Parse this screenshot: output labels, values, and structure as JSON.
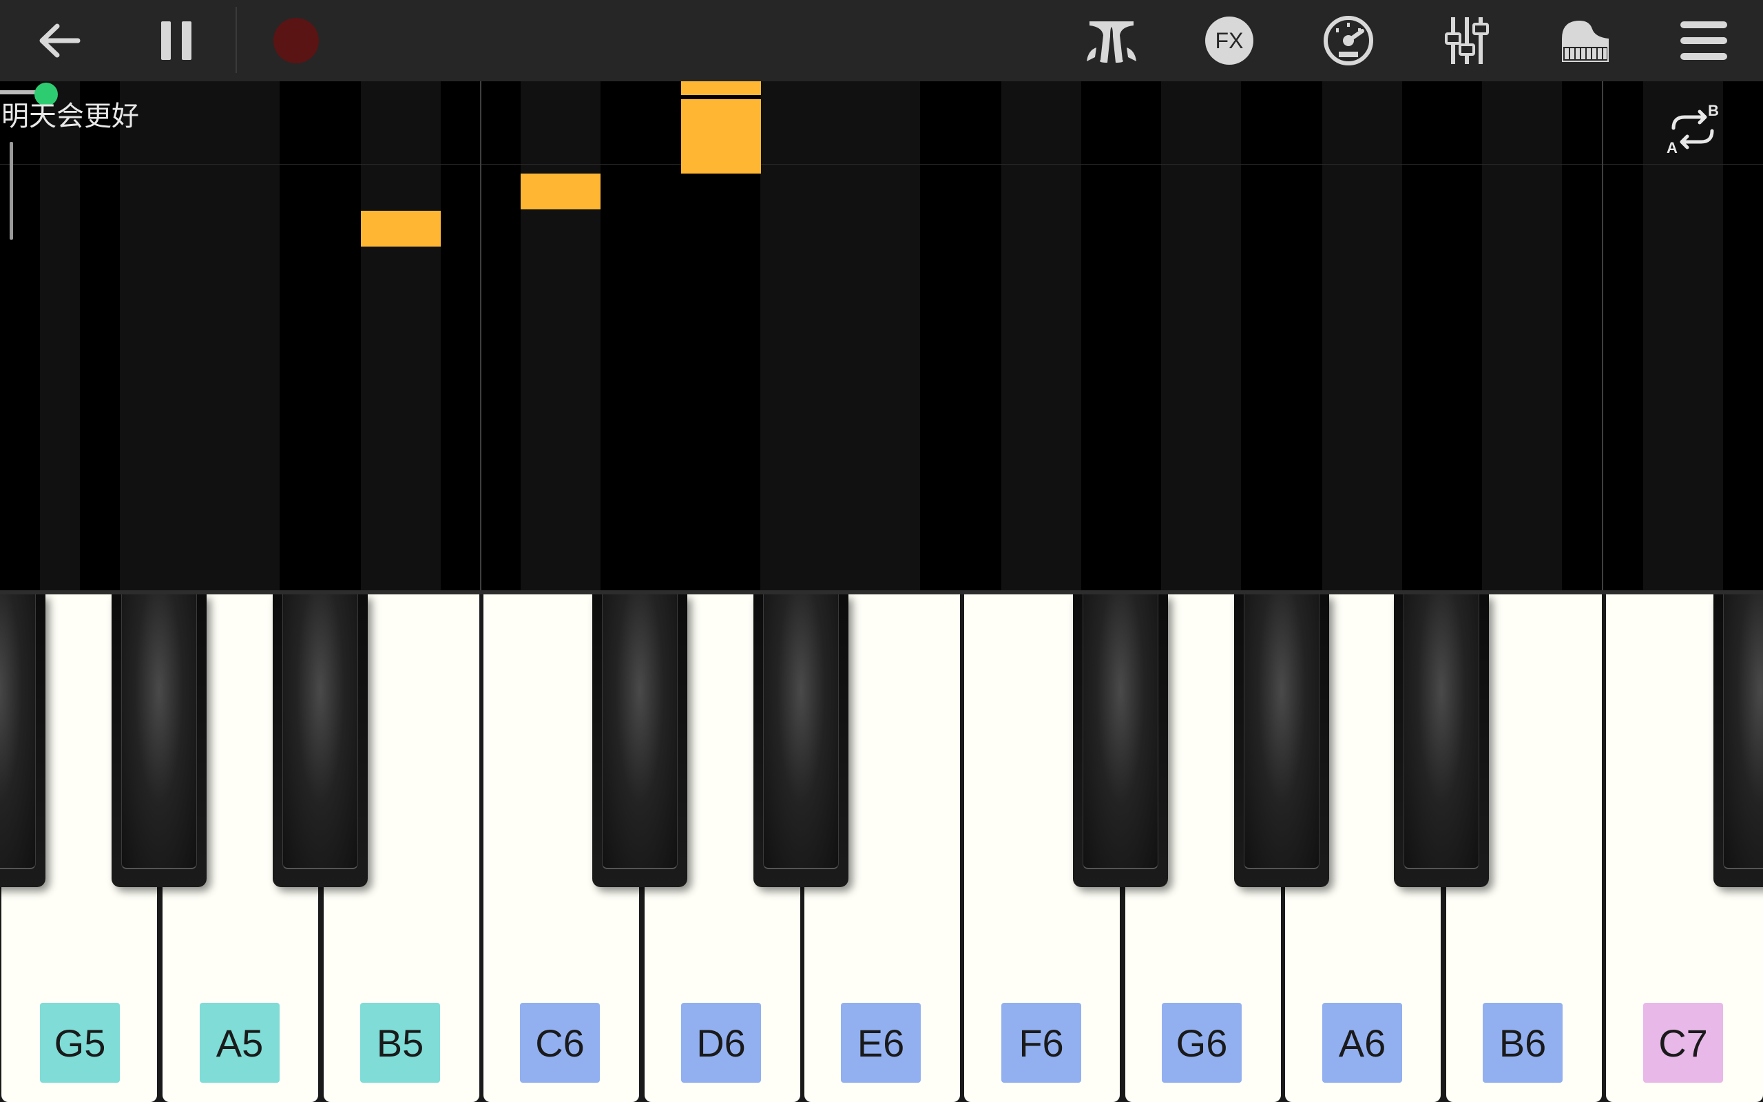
{
  "toolbar": {
    "left": [
      {
        "name": "back-arrow-icon"
      },
      {
        "name": "pause-icon"
      },
      {
        "name": "record-icon"
      }
    ],
    "right": [
      {
        "name": "metronome-icon"
      },
      {
        "name": "fx-icon",
        "label": "FX"
      },
      {
        "name": "tempo-icon"
      },
      {
        "name": "mixer-icon"
      },
      {
        "name": "piano-icon"
      },
      {
        "name": "menu-icon"
      }
    ],
    "record_color": "#5a1414",
    "icon_color": "#d8d8d8"
  },
  "song": {
    "title": "明天会更好",
    "progress_accent": "#2ecc71"
  },
  "ab_loop": {
    "a_label": "A",
    "b_label": "B"
  },
  "notes_color": "#ffb733",
  "keyboard": {
    "white_keys": [
      {
        "note": "G5",
        "color": "#7fdcd6"
      },
      {
        "note": "A5",
        "color": "#7fdcd6"
      },
      {
        "note": "B5",
        "color": "#7fdcd6"
      },
      {
        "note": "C6",
        "color": "#92b0f0"
      },
      {
        "note": "D6",
        "color": "#92b0f0"
      },
      {
        "note": "E6",
        "color": "#92b0f0"
      },
      {
        "note": "F6",
        "color": "#92b0f0"
      },
      {
        "note": "G6",
        "color": "#92b0f0"
      },
      {
        "note": "A6",
        "color": "#92b0f0"
      },
      {
        "note": "B6",
        "color": "#92b0f0"
      },
      {
        "note": "C7",
        "color": "#e8b8e8"
      }
    ]
  }
}
